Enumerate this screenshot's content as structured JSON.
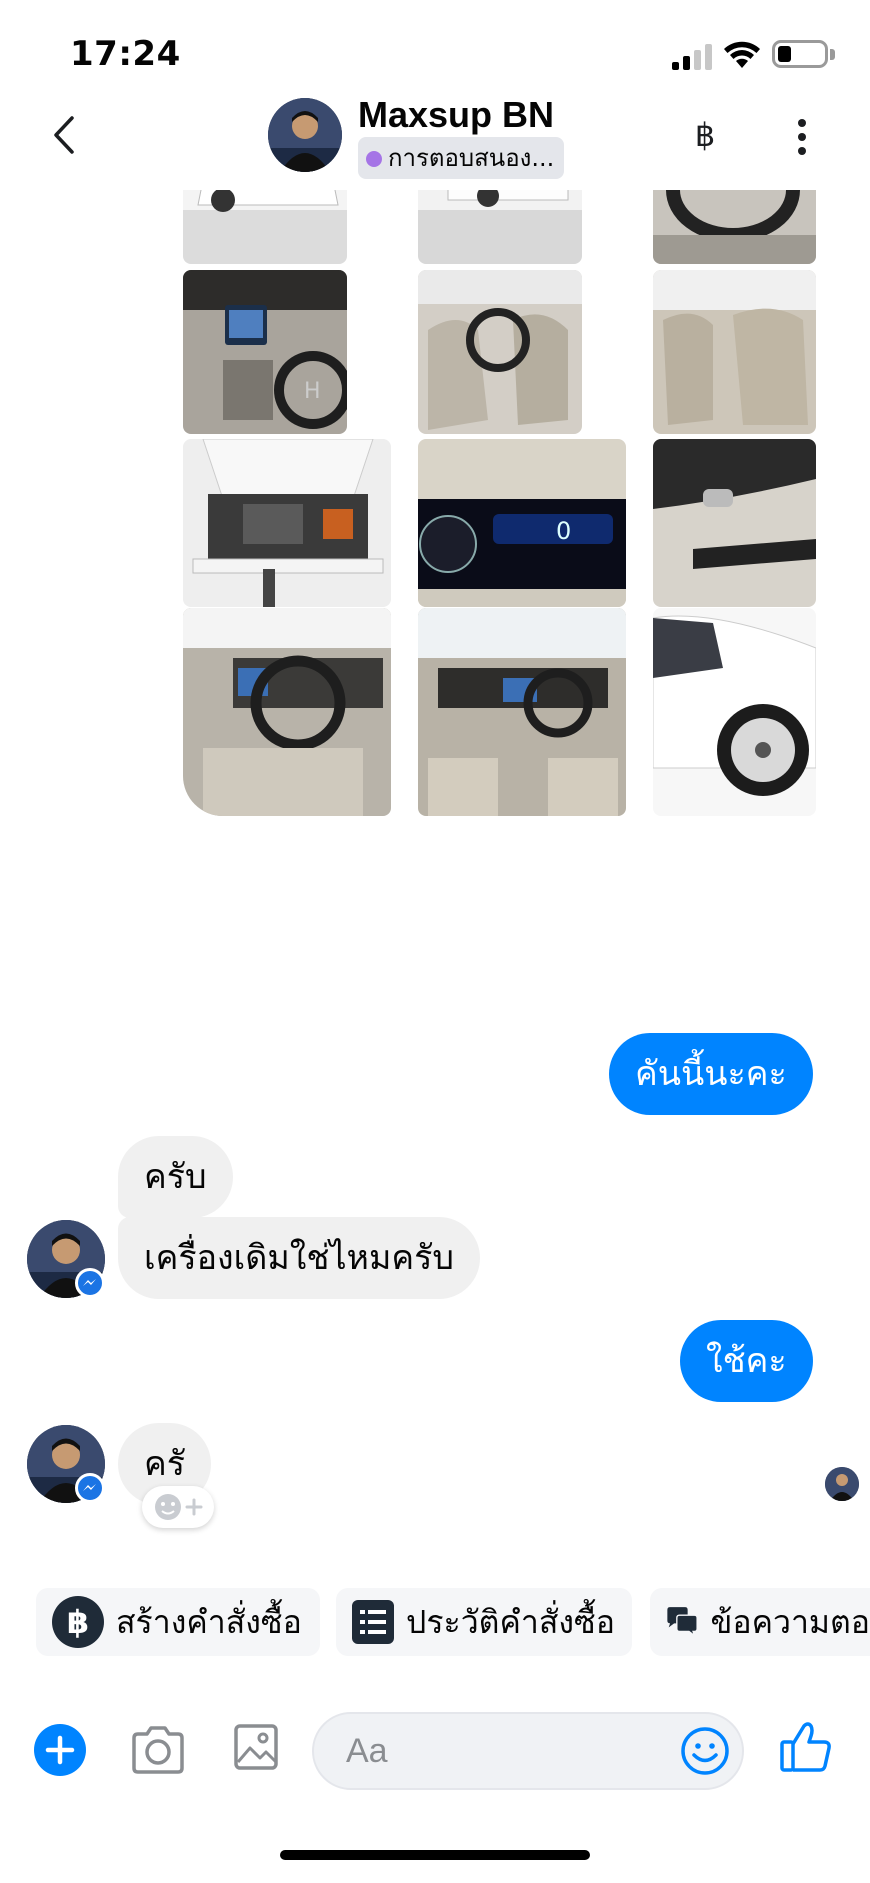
{
  "status_bar": {
    "time": "17:24"
  },
  "header": {
    "contact_name": "Maxsup BN",
    "status_text": "การตอบสนอง...",
    "baht_symbol": "฿"
  },
  "messages": {
    "out_1": "คันนี้นะคะ",
    "in_1": "ครับ",
    "in_2": "เครื่องเดิมใช่ไหมครับ",
    "out_2": "ใช้คะ",
    "in_3": "ครั"
  },
  "quick_actions": [
    {
      "label": "สร้างคำสั่งซื้อ"
    },
    {
      "label": "ประวัติคำสั่งซื้อ"
    },
    {
      "label": "ข้อความตอ"
    }
  ],
  "composer": {
    "placeholder": "Aa"
  },
  "colors": {
    "accent": "#0084ff",
    "incoming_bubble": "#f0f0f0",
    "status_dot": "#a574e6",
    "messenger_badge": "#1b74e4"
  },
  "icons": [
    "back-arrow-icon",
    "baht-icon",
    "more-vertical-icon",
    "messenger-icon",
    "smiley-plus-icon",
    "plus-icon",
    "camera-icon",
    "image-icon",
    "emoji-icon",
    "thumbs-up-icon",
    "order-history-icon",
    "chat-bubbles-icon"
  ]
}
